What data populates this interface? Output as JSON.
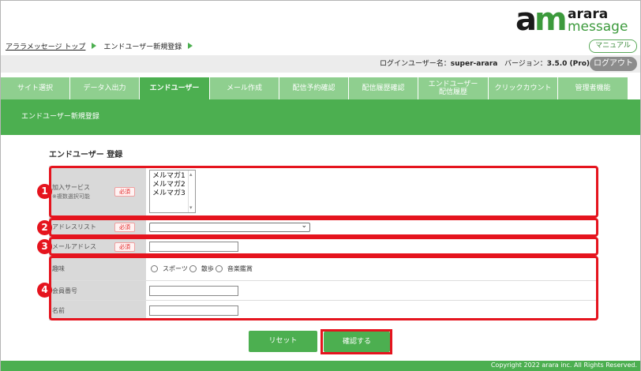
{
  "logo": {
    "mark": "am",
    "line1": "arara",
    "line2": "message"
  },
  "breadcrumb": {
    "home": "アララメッセージ トップ",
    "current": "エンドユーザー新規登録"
  },
  "manual_label": "マニュアル",
  "user_info": {
    "user_label": "ログインユーザー名：",
    "user_name": "super-arara",
    "version_label": "バージョン：",
    "version": "3.5.0 (Pro)"
  },
  "logout_label": "ログアウト",
  "tabs": [
    {
      "label": "サイト選択"
    },
    {
      "label": "データ入出力"
    },
    {
      "label": "エンドユーザー"
    },
    {
      "label": "メール作成"
    },
    {
      "label": "配信予約確認"
    },
    {
      "label": "配信履歴確認"
    },
    {
      "label": "エンドユーザー\n配信履歴"
    },
    {
      "label": "クリックカウント"
    },
    {
      "label": "管理者機能"
    }
  ],
  "subheader": "エンドユーザー新規登録",
  "section_title": "エンドユーザー 登録",
  "required_label": "必須",
  "fields": {
    "services": {
      "label": "加入サービス",
      "note": "※複数選択可能",
      "options": [
        "メルマガ1",
        "メルマガ2",
        "メルマガ3"
      ]
    },
    "address_list": {
      "label": "アドレスリスト",
      "value": ""
    },
    "email": {
      "label": "メールアドレス",
      "value": ""
    },
    "hobby": {
      "label": "趣味",
      "options": [
        "スポーツ",
        "散歩",
        "音楽鑑賞"
      ]
    },
    "member_no": {
      "label": "会員番号",
      "value": ""
    },
    "name": {
      "label": "名前",
      "value": ""
    }
  },
  "annotations": [
    "1",
    "2",
    "3",
    "4"
  ],
  "annotation_color": "#e5141e",
  "accent_color": "#4caf50",
  "buttons": {
    "reset": "リセット",
    "confirm": "確認する"
  },
  "footer": "Copyright 2022 arara inc. All Rights Reserved."
}
